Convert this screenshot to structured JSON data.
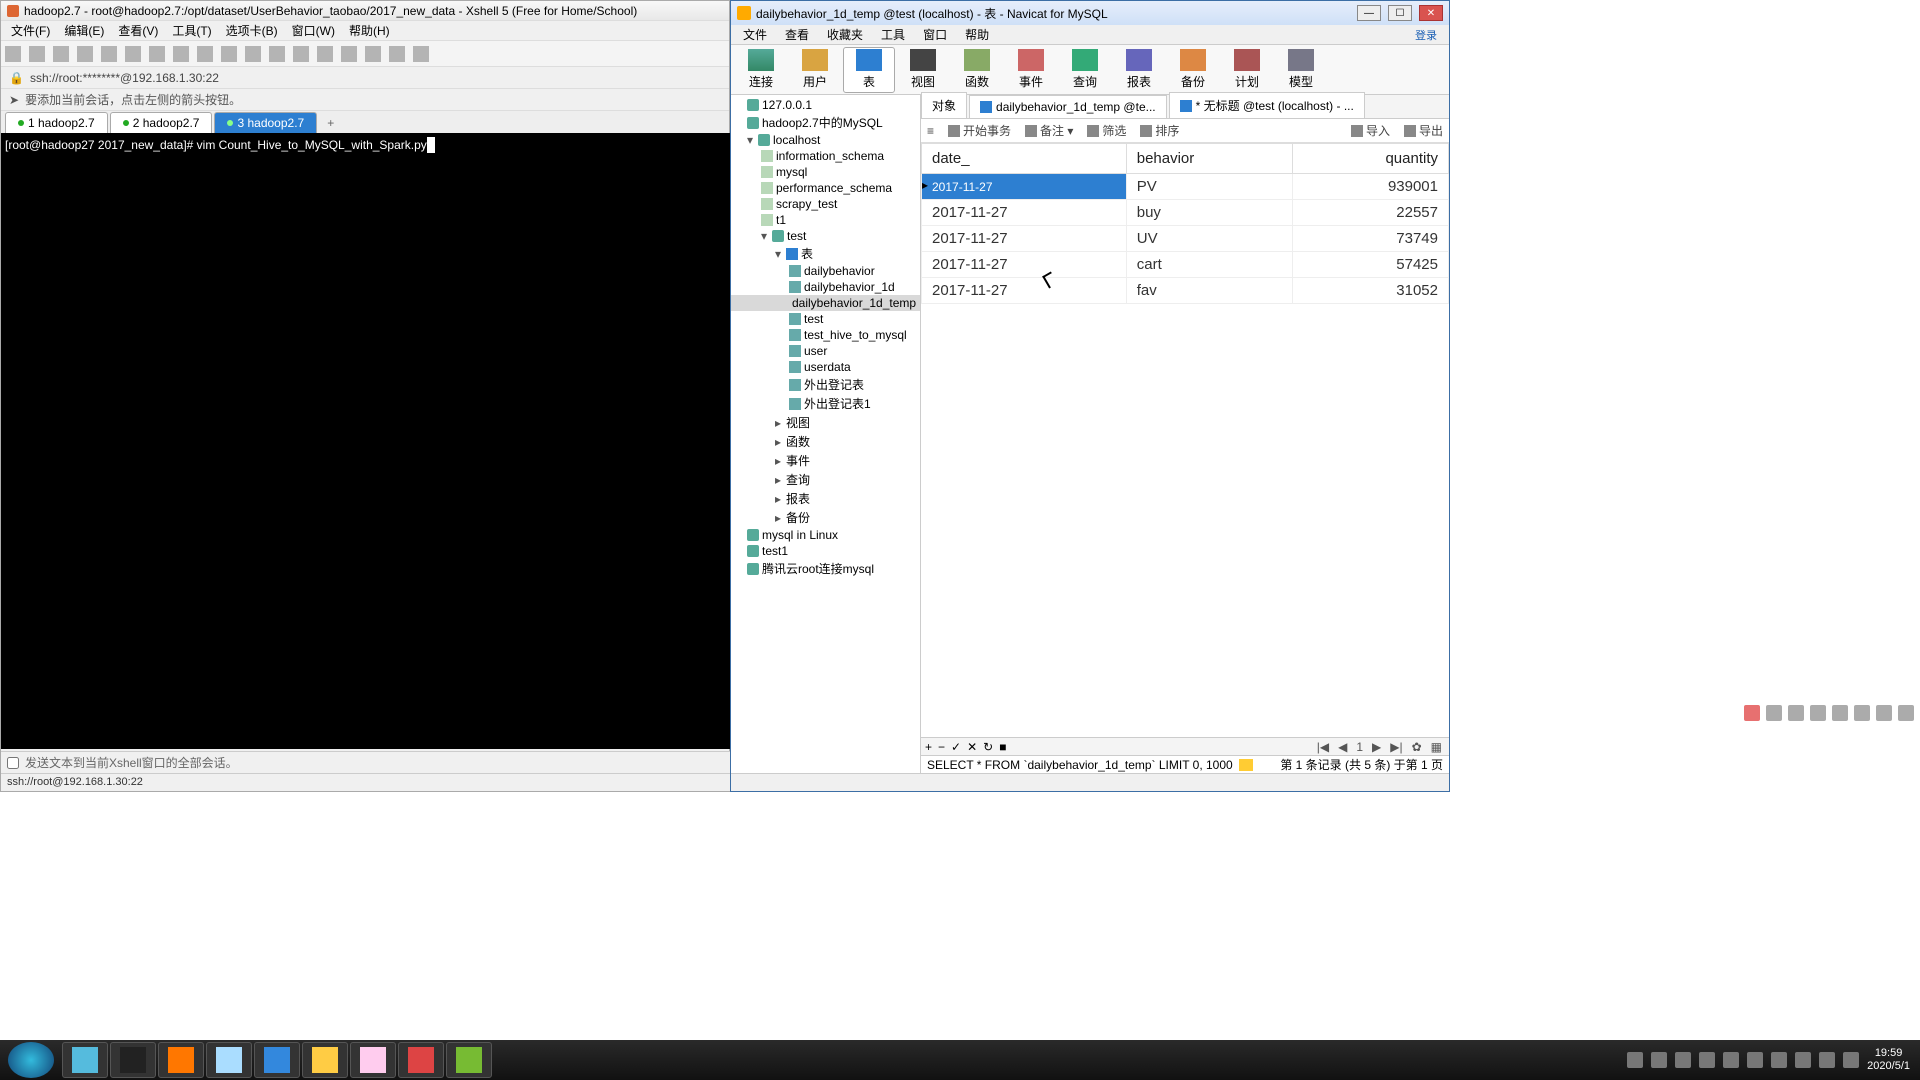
{
  "xshell": {
    "title": "hadoop2.7 - root@hadoop2.7:/opt/dataset/UserBehavior_taobao/2017_new_data - Xshell 5 (Free for Home/School)",
    "menus": [
      "文件(F)",
      "编辑(E)",
      "查看(V)",
      "工具(T)",
      "选项卡(B)",
      "窗口(W)",
      "帮助(H)"
    ],
    "address": "ssh://root:********@192.168.1.30:22",
    "hint": "要添加当前会话，点击左侧的箭头按钮。",
    "tabs": [
      "1 hadoop2.7",
      "2 hadoop2.7",
      "3 hadoop2.7"
    ],
    "active_tab": 2,
    "prompt": "[root@hadoop27 2017_new_data]# vim Count_Hive_to_MySQL_with_Spark.py",
    "sendline": "发送文本到当前Xshell窗口的全部会话。",
    "status": "ssh://root@192.168.1.30:22"
  },
  "navicat": {
    "title": "dailybehavior_1d_temp @test (localhost) - 表 - Navicat for MySQL",
    "menus": [
      "文件",
      "查看",
      "收藏夹",
      "工具",
      "窗口",
      "帮助"
    ],
    "login": "登录",
    "ribbon": [
      "连接",
      "用户",
      "表",
      "视图",
      "函数",
      "事件",
      "查询",
      "报表",
      "备份",
      "计划",
      "模型"
    ],
    "ribbon_active": 2,
    "tree": {
      "conns": [
        "127.0.0.1",
        "hadoop2.7中的MySQL"
      ],
      "localhost": "localhost",
      "schemas": [
        "information_schema",
        "mysql",
        "performance_schema",
        "scrapy_test",
        "t1"
      ],
      "test": "test",
      "tblnode": "表",
      "tables": [
        "dailybehavior",
        "dailybehavior_1d",
        "dailybehavior_1d_temp",
        "test",
        "test_hive_to_mysql",
        "user",
        "userdata",
        "外出登记表",
        "外出登记表1"
      ],
      "table_sel": 2,
      "sub": [
        "视图",
        "函数",
        "事件",
        "查询",
        "报表",
        "备份"
      ],
      "otherconn": [
        "mysql in Linux",
        "test1",
        "腾讯云root连接mysql"
      ]
    },
    "ctabs": {
      "obj": "对象",
      "t1": "dailybehavior_1d_temp @te...",
      "t2": "* 无标题 @test (localhost) - ..."
    },
    "tbar": {
      "a": "开始事务",
      "b": "备注 ▾",
      "c": "筛选",
      "d": "排序",
      "e": "导入",
      "f": "导出"
    },
    "columns": [
      "date_",
      "behavior",
      "quantity"
    ],
    "rows": [
      {
        "date_": "2017-11-27",
        "behavior": "PV",
        "quantity": "939001"
      },
      {
        "date_": "2017-11-27",
        "behavior": "buy",
        "quantity": "22557"
      },
      {
        "date_": "2017-11-27",
        "behavior": "UV",
        "quantity": "73749"
      },
      {
        "date_": "2017-11-27",
        "behavior": "cart",
        "quantity": "57425"
      },
      {
        "date_": "2017-11-27",
        "behavior": "fav",
        "quantity": "31052"
      }
    ],
    "sel_row": 0,
    "page_pos": "1",
    "sql": "SELECT * FROM `dailybehavior_1d_temp` LIMIT 0, 1000",
    "pageinfo": "第 1 条记录 (共 5 条) 于第 1 页"
  },
  "taskbar": {
    "time": "19:59",
    "date": "2020/5/1"
  }
}
